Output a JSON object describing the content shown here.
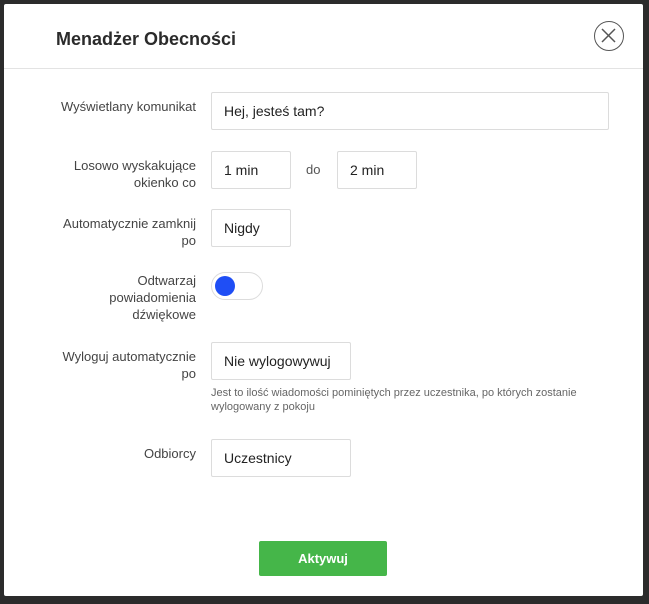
{
  "dialog": {
    "title": "Menadżer Obecności",
    "close_icon": "close-icon"
  },
  "form": {
    "message": {
      "label": "Wyświetlany komunikat",
      "value": "Hej, jesteś tam?"
    },
    "popup_interval": {
      "label_line1": "Losowo wyskakujące",
      "label_line2": "okienko co",
      "from_value": "1 min",
      "between_text": "do",
      "to_value": "2 min"
    },
    "auto_close": {
      "label_line1": "Automatycznie zamknij",
      "label_line2": "po",
      "value": "Nigdy"
    },
    "sound": {
      "label_line1": "Odtwarzaj",
      "label_line2": "powiadomienia",
      "label_line3": "dźwiękowe",
      "toggle_color": "#1f4ef5"
    },
    "auto_logout": {
      "label_line1": "Wyloguj automatycznie",
      "label_line2": "po",
      "value": "Nie wylogowywuj",
      "hint": "Jest to ilość wiadomości pominiętych przez uczestnika, po których zostanie wylogowany z pokoju"
    },
    "recipients": {
      "label": "Odbiorcy",
      "value": "Uczestnicy"
    }
  },
  "footer": {
    "activate_label": "Aktywuj",
    "activate_color": "#45b649"
  }
}
